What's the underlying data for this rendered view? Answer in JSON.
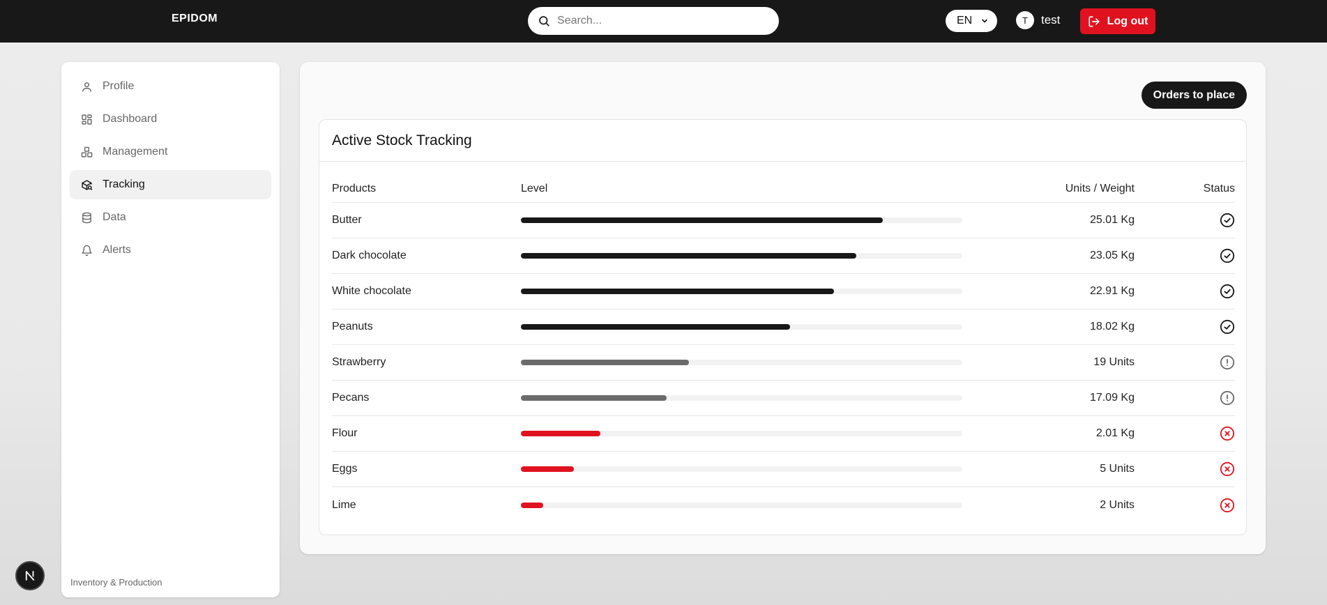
{
  "header": {
    "logo": "EPIDOM",
    "search_placeholder": "Search...",
    "language": "EN",
    "user_initial": "T",
    "user_name": "test",
    "logout_label": "Log out"
  },
  "sidebar": {
    "items": [
      {
        "label": "Profile",
        "icon": "user-icon",
        "active": false
      },
      {
        "label": "Dashboard",
        "icon": "dashboard-icon",
        "active": false
      },
      {
        "label": "Management",
        "icon": "boxes-icon",
        "active": false
      },
      {
        "label": "Tracking",
        "icon": "package-search-icon",
        "active": true
      },
      {
        "label": "Data",
        "icon": "database-icon",
        "active": false
      },
      {
        "label": "Alerts",
        "icon": "bell-icon",
        "active": false
      }
    ],
    "footer": "Inventory & Production"
  },
  "main": {
    "orders_button": "Orders to place",
    "card_title": "Active Stock Tracking",
    "columns": {
      "products": "Products",
      "level": "Level",
      "units": "Units / Weight",
      "status": "Status"
    },
    "rows": [
      {
        "product": "Butter",
        "level": 0.82,
        "units": "25.01 Kg",
        "status": "ok"
      },
      {
        "product": "Dark chocolate",
        "level": 0.76,
        "units": "23.05 Kg",
        "status": "ok"
      },
      {
        "product": "White chocolate",
        "level": 0.71,
        "units": "22.91 Kg",
        "status": "ok"
      },
      {
        "product": "Peanuts",
        "level": 0.61,
        "units": "18.02 Kg",
        "status": "ok"
      },
      {
        "product": "Strawberry",
        "level": 0.38,
        "units": "19 Units",
        "status": "warning"
      },
      {
        "product": "Pecans",
        "level": 0.33,
        "units": "17.09 Kg",
        "status": "warning"
      },
      {
        "product": "Flour",
        "level": 0.18,
        "units": "2.01 Kg",
        "status": "critical"
      },
      {
        "product": "Eggs",
        "level": 0.12,
        "units": "5 Units",
        "status": "critical"
      },
      {
        "product": "Lime",
        "level": 0.05,
        "units": "2 Units",
        "status": "critical"
      }
    ]
  },
  "colors": {
    "ok": "#181818",
    "warning": "#6b6b6b",
    "critical": "#e0121f",
    "topbar": "#181818"
  }
}
